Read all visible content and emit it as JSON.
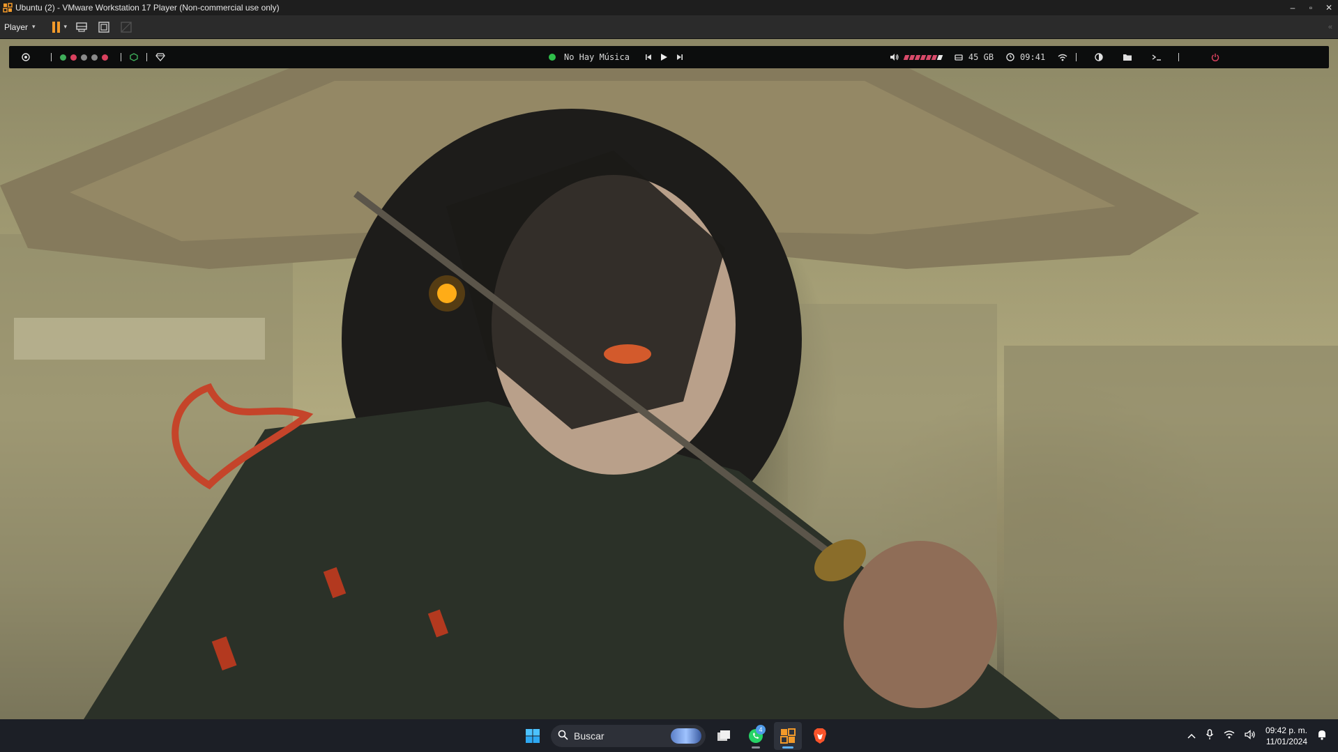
{
  "window": {
    "title": "Ubuntu (2) - VMware Workstation 17 Player (Non-commercial use only)",
    "minimize": "–",
    "maximize": "▫",
    "close": "✕"
  },
  "toolbar": {
    "player_label": "Player",
    "player_caret": "▾",
    "pause_caret": "▾",
    "right_arrows": "«"
  },
  "panel": {
    "music_label": "No Hay Música",
    "disk_label": "45 GB",
    "time_label": "09:41",
    "volume_level": 0.86,
    "colors": {
      "background": "#0c0d0d",
      "music_status": "#2fbf4a",
      "volume_bar": "#d94a6a",
      "workspace_green": "#3fae5a",
      "workspace_red": "#d9415e",
      "workspace_grey": "#8a8a8a"
    }
  },
  "taskbar": {
    "search_placeholder": "Buscar",
    "whatsapp_badge": "4",
    "clock_time": "09:42 p. m.",
    "clock_date": "11/01/2024"
  }
}
